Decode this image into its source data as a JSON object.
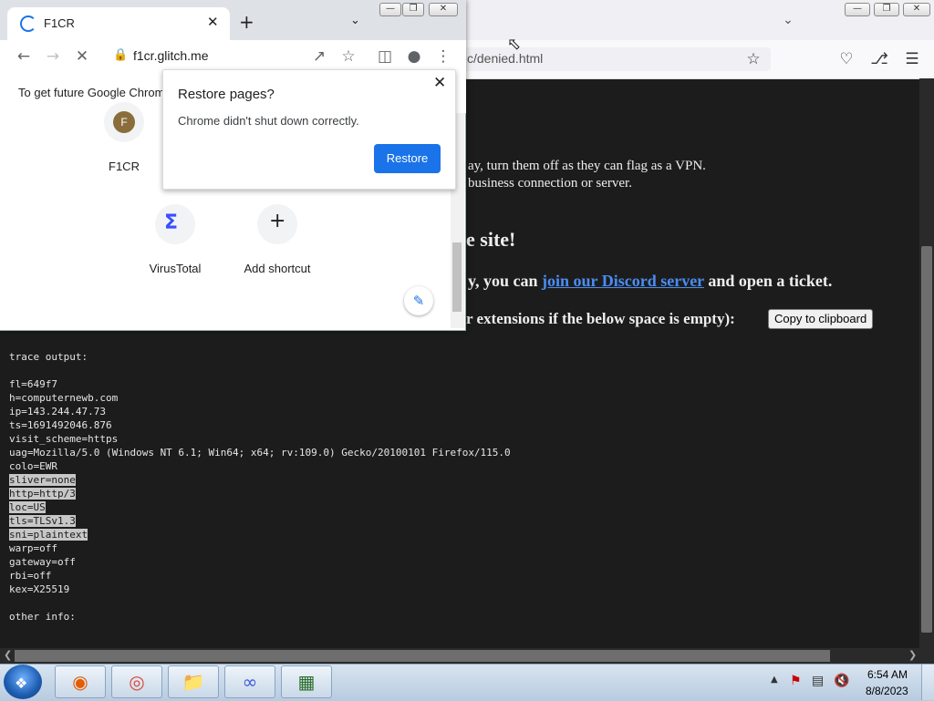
{
  "firefox": {
    "url_visible": "c/denied.html",
    "page": {
      "line1": "ay, turn them off as they can flag as a VPN.",
      "line2": "business connection or server.",
      "heading": "e site!",
      "discord_prefix": "y, you can ",
      "discord_link": "join our Discord server",
      "discord_suffix": " and open a ticket.",
      "extensions_text": "r extensions if the below space is empty):",
      "copy_button": "Copy to clipboard",
      "trace_header": "trace output:",
      "trace_lines": [
        {
          "text": "fl=649f7",
          "selected": false
        },
        {
          "text": "h=computernewb.com",
          "selected": false
        },
        {
          "text": "ip=143.244.47.73",
          "selected": false
        },
        {
          "text": "ts=1691492046.876",
          "selected": false
        },
        {
          "text": "visit_scheme=https",
          "selected": false
        },
        {
          "text": "uag=Mozilla/5.0 (Windows NT 6.1; Win64; x64; rv:109.0) Gecko/20100101 Firefox/115.0",
          "selected": false
        },
        {
          "text": "colo=EWR",
          "selected": false
        },
        {
          "text": "sliver=none",
          "selected": true
        },
        {
          "text": "http=http/3",
          "selected": true
        },
        {
          "text": "loc=US",
          "selected": true
        },
        {
          "text": "tls=TLSv1.3",
          "selected": true
        },
        {
          "text": "sni=plaintext",
          "selected": true
        },
        {
          "text": "warp=off",
          "selected": false
        },
        {
          "text": "gateway=off",
          "selected": false
        },
        {
          "text": "rbi=off",
          "selected": false
        },
        {
          "text": "kex=X25519",
          "selected": false
        }
      ],
      "other_info": "other info:"
    }
  },
  "chrome": {
    "tab_title": "F1CR",
    "url": "f1cr.glitch.me",
    "infobar_text": "To get future Google Chrom",
    "shortcuts": [
      {
        "label": "F1CR",
        "initial": "F"
      },
      {
        "label": "VirusTotal"
      },
      {
        "label": "Add shortcut"
      }
    ],
    "restore_popup": {
      "title": "Restore pages?",
      "body": "Chrome didn't shut down correctly.",
      "button": "Restore"
    }
  },
  "taskbar": {
    "time": "6:54 AM",
    "date": "8/8/2023"
  }
}
